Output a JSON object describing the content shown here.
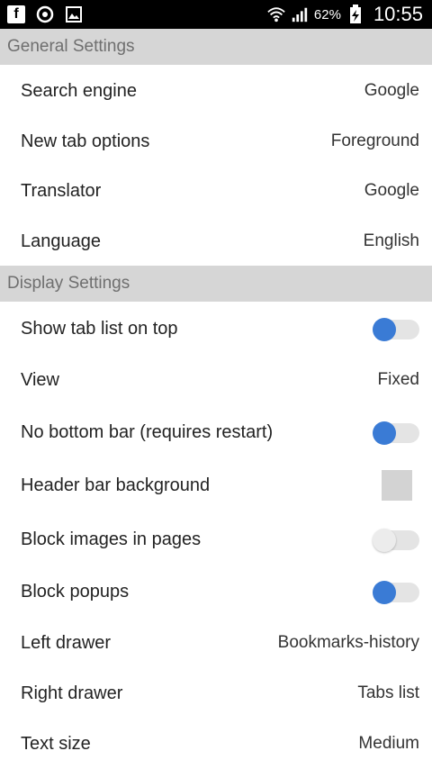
{
  "status_bar": {
    "left_icons": [
      "facebook-icon",
      "browser-icon",
      "gallery-icon"
    ],
    "battery": "62%",
    "time": "10:55"
  },
  "sections": {
    "general": {
      "title": "General Settings"
    },
    "display": {
      "title": "Display Settings"
    }
  },
  "general_rows": {
    "search_engine": {
      "label": "Search engine",
      "value": "Google"
    },
    "new_tab_options": {
      "label": "New tab options",
      "value": "Foreground"
    },
    "translator": {
      "label": "Translator",
      "value": "Google"
    },
    "language": {
      "label": "Language",
      "value": "English"
    }
  },
  "display_rows": {
    "show_tab_list": {
      "label": "Show tab list on top",
      "enabled": true
    },
    "view": {
      "label": "View",
      "value": "Fixed"
    },
    "no_bottom_bar": {
      "label": "No bottom bar (requires restart)",
      "enabled": true
    },
    "header_bar_background": {
      "label": "Header bar background",
      "color": "#d3d3d3"
    },
    "block_images": {
      "label": "Block images in pages",
      "enabled": false
    },
    "block_popups": {
      "label": "Block popups",
      "enabled": true
    },
    "left_drawer": {
      "label": "Left drawer",
      "value": "Bookmarks-history"
    },
    "right_drawer": {
      "label": "Right drawer",
      "value": "Tabs list"
    },
    "text_size": {
      "label": "Text size",
      "value": "Medium"
    }
  },
  "colors": {
    "accent": "#3a7bd5",
    "section_bg": "#d6d6d6",
    "section_text": "#6f6f6f"
  }
}
